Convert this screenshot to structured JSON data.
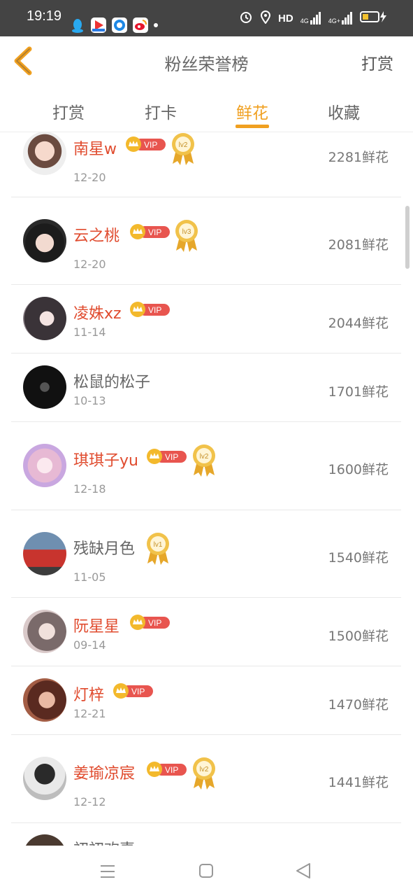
{
  "status": {
    "time": "19:19",
    "network": "HD",
    "signal1": "4G",
    "signal2": "4G+"
  },
  "header": {
    "title": "粉丝荣誉榜",
    "action": "打赏"
  },
  "tabs": [
    {
      "label": "打赏"
    },
    {
      "label": "打卡"
    },
    {
      "label": "鲜花"
    },
    {
      "label": "收藏"
    }
  ],
  "active_tab": 2,
  "vip_label": "VIP",
  "entries": [
    {
      "name": "南星w",
      "date": "12-20",
      "amount": "2281鲜花",
      "vip": true,
      "medal": "lv2"
    },
    {
      "name": "云之桃",
      "date": "12-20",
      "amount": "2081鲜花",
      "vip": true,
      "medal": "lv3"
    },
    {
      "name": "凌姝xz",
      "date": "11-14",
      "amount": "2044鲜花",
      "vip": true,
      "medal": ""
    },
    {
      "name": "松鼠的松子",
      "date": "10-13",
      "amount": "1701鲜花",
      "vip": false,
      "medal": ""
    },
    {
      "name": "琪琪子yu",
      "date": "12-18",
      "amount": "1600鲜花",
      "vip": true,
      "medal": "lv2"
    },
    {
      "name": "残缺月色",
      "date": "11-05",
      "amount": "1540鲜花",
      "vip": false,
      "medal": "lv1"
    },
    {
      "name": "阮星星",
      "date": "09-14",
      "amount": "1500鲜花",
      "vip": true,
      "medal": ""
    },
    {
      "name": "灯梓",
      "date": "12-21",
      "amount": "1470鲜花",
      "vip": true,
      "medal": ""
    },
    {
      "name": "姜瑜凉宸",
      "date": "12-12",
      "amount": "1441鲜花",
      "vip": true,
      "medal": "lv2"
    },
    {
      "name": "初初欢喜",
      "date": "",
      "amount": "",
      "vip": false,
      "medal": ""
    }
  ],
  "colors": {
    "accent": "#f0a020",
    "vip_name": "#e04b2e",
    "vip_badge": "#e8554f"
  }
}
